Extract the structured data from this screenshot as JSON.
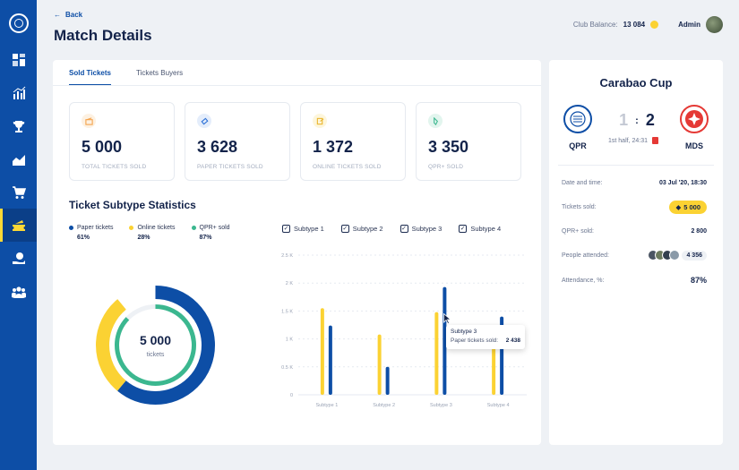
{
  "header": {
    "back_label": "Back",
    "title": "Match Details",
    "club_balance_label": "Club Balance:",
    "club_balance_value": "13 084",
    "user_name": "Admin"
  },
  "sidebar": {
    "items": [
      {
        "icon": "dashboard-icon"
      },
      {
        "icon": "statistics-icon"
      },
      {
        "icon": "trophy-icon"
      },
      {
        "icon": "chart-area-icon"
      },
      {
        "icon": "cart-icon"
      },
      {
        "icon": "tickets-icon",
        "active": true
      },
      {
        "icon": "money-hand-icon"
      },
      {
        "icon": "users-icon"
      }
    ]
  },
  "tabs": [
    {
      "label": "Sold Tickets",
      "active": true
    },
    {
      "label": "Tickets Buyers",
      "active": false
    }
  ],
  "stats": [
    {
      "value": "5 000",
      "label": "TOTAL TICKETS SOLD",
      "icon": "ticket-stub-icon",
      "color": "#f4a24a"
    },
    {
      "value": "3 628",
      "label": "PAPER TICKETS SOLD",
      "icon": "ticket-icon",
      "color": "#2a6fd6"
    },
    {
      "value": "1 372",
      "label": "ONLINE TICKETS SOLD",
      "icon": "online-ticket-icon",
      "color": "#e9b52c"
    },
    {
      "value": "3 350",
      "label": "QPR+ SOLD",
      "icon": "qpr-plus-icon",
      "color": "#3bb78f"
    }
  ],
  "subtype_stats": {
    "title": "Ticket Subtype Statistics",
    "legend": [
      {
        "name": "Paper tickets",
        "pct": "61%",
        "color": "#0d4ea6"
      },
      {
        "name": "Online tickets",
        "pct": "28%",
        "color": "#fbd233"
      },
      {
        "name": "QPR+ sold",
        "pct": "87%",
        "color": "#3bb78f"
      }
    ],
    "filters": [
      "Subtype 1",
      "Subtype 2",
      "Subtype 3",
      "Subtype 4"
    ],
    "donut_value": "5 000",
    "donut_label": "tickets"
  },
  "chart_data": {
    "type": "bar",
    "categories": [
      "Subtype 1",
      "Subtype 2",
      "Subtype 3",
      "Subtype 4"
    ],
    "y_ticks": [
      "0",
      "0.5 K",
      "1 K",
      "1.5 K",
      "2 K",
      "2.5 K"
    ],
    "ylim": [
      0,
      2500
    ],
    "series": [
      {
        "values": [
          1550,
          1080,
          1480,
          920
        ],
        "color": "#fbd233"
      },
      {
        "values": [
          1240,
          500,
          1930,
          1400
        ],
        "color": "#0d4ea6"
      }
    ],
    "donut": [
      {
        "name": "Paper tickets",
        "value": 61,
        "color": "#0d4ea6"
      },
      {
        "name": "Online tickets",
        "value": 28,
        "color": "#fbd233"
      },
      {
        "name": "QPR+ sold",
        "value": 87,
        "color": "#3bb78f"
      }
    ],
    "tooltip": {
      "title": "Subtype 3",
      "label": "Paper tickets sold:",
      "value": "2 438"
    }
  },
  "match": {
    "cup": "Carabao Cup",
    "home_team": "QPR",
    "away_team": "MDS",
    "home_score": "1",
    "separator": ":",
    "away_score": "2",
    "time": "1st half, 24:31",
    "details": [
      {
        "label": "Date and time:",
        "value": "03 Jul '20, 18:30"
      },
      {
        "label": "Tickets sold:",
        "value": "5 000"
      },
      {
        "label": "QPR+ sold:",
        "value": "2 800"
      },
      {
        "label": "People attended:",
        "value": "4 356"
      },
      {
        "label": "Attendance, %:",
        "value": "87%"
      }
    ]
  }
}
